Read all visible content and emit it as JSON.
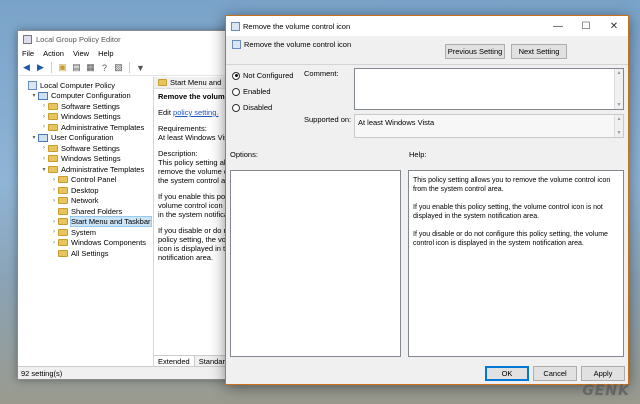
{
  "editor": {
    "title": "Local Group Policy Editor",
    "menu": [
      "File",
      "Action",
      "View",
      "Help"
    ],
    "tree": [
      {
        "label": "Local Computer Policy",
        "indent": 0,
        "arrow": "",
        "icon": "computer-icon"
      },
      {
        "label": "Computer Configuration",
        "indent": 1,
        "arrow": "▾",
        "icon": "computer-icon"
      },
      {
        "label": "Software Settings",
        "indent": 2,
        "arrow": "›",
        "icon": "folder-icon"
      },
      {
        "label": "Windows Settings",
        "indent": 2,
        "arrow": "›",
        "icon": "folder-icon"
      },
      {
        "label": "Administrative Templates",
        "indent": 2,
        "arrow": "›",
        "icon": "folder-icon"
      },
      {
        "label": "User Configuration",
        "indent": 1,
        "arrow": "▾",
        "icon": "computer-icon"
      },
      {
        "label": "Software Settings",
        "indent": 2,
        "arrow": "›",
        "icon": "folder-icon"
      },
      {
        "label": "Windows Settings",
        "indent": 2,
        "arrow": "›",
        "icon": "folder-icon"
      },
      {
        "label": "Administrative Templates",
        "indent": 2,
        "arrow": "▾",
        "icon": "folder-icon"
      },
      {
        "label": "Control Panel",
        "indent": 3,
        "arrow": "›",
        "icon": "folder-icon"
      },
      {
        "label": "Desktop",
        "indent": 3,
        "arrow": "›",
        "icon": "folder-icon"
      },
      {
        "label": "Network",
        "indent": 3,
        "arrow": "›",
        "icon": "folder-icon"
      },
      {
        "label": "Shared Folders",
        "indent": 3,
        "arrow": "",
        "icon": "folder-icon"
      },
      {
        "label": "Start Menu and Taskbar",
        "indent": 3,
        "arrow": "›",
        "icon": "folder-icon",
        "selected": true
      },
      {
        "label": "System",
        "indent": 3,
        "arrow": "›",
        "icon": "folder-icon"
      },
      {
        "label": "Windows Components",
        "indent": 3,
        "arrow": "›",
        "icon": "folder-icon"
      },
      {
        "label": "All Settings",
        "indent": 3,
        "arrow": "",
        "icon": "folder-icon"
      }
    ],
    "pane_header": "Start Menu and",
    "pane_title": "Remove the volume",
    "edit_prefix": "Edit",
    "edit_link": "policy setting.",
    "requirements_label": "Requirements:",
    "requirements_value": "At least Windows Vista",
    "description_label": "Description:",
    "desc_lines": [
      "This policy setting allo",
      "remove the volume co",
      "the system control are"
    ],
    "enable_lines": [
      "If you enable this polic",
      "volume control icon is",
      "in the system notificat"
    ],
    "disable_lines": [
      "If you disable or do no",
      "policy setting, the volu",
      "icon is displayed in the",
      "notification area."
    ],
    "tabs": [
      "Extended",
      "Standard"
    ],
    "status": "92 setting(s)"
  },
  "dialog": {
    "title": "Remove the volume control icon",
    "window_buttons": [
      "—",
      "☐",
      "✕"
    ],
    "heading": "Remove the volume control icon",
    "prev_button": "Previous Setting",
    "next_button": "Next Setting",
    "radios": [
      {
        "label": "Not Configured",
        "selected": true
      },
      {
        "label": "Enabled",
        "selected": false
      },
      {
        "label": "Disabled",
        "selected": false
      }
    ],
    "comment_label": "Comment:",
    "supported_label": "Supported on:",
    "supported_value": "At least Windows Vista",
    "options_label": "Options:",
    "help_label": "Help:",
    "help_paragraphs": [
      "This policy setting allows you to remove the volume control icon from the system control area.",
      "If you enable this policy setting, the volume control icon is not displayed in the system notification area.",
      "If you disable or do not configure this policy setting, the volume control icon is displayed in the system notification area."
    ],
    "ok_button": "OK",
    "cancel_button": "Cancel",
    "apply_button": "Apply"
  },
  "colors": {
    "accent": "#0078d7",
    "dialog_border": "#c8701a",
    "link": "#1a55c4",
    "selection": "#cce4f7"
  },
  "watermark": "GENK"
}
